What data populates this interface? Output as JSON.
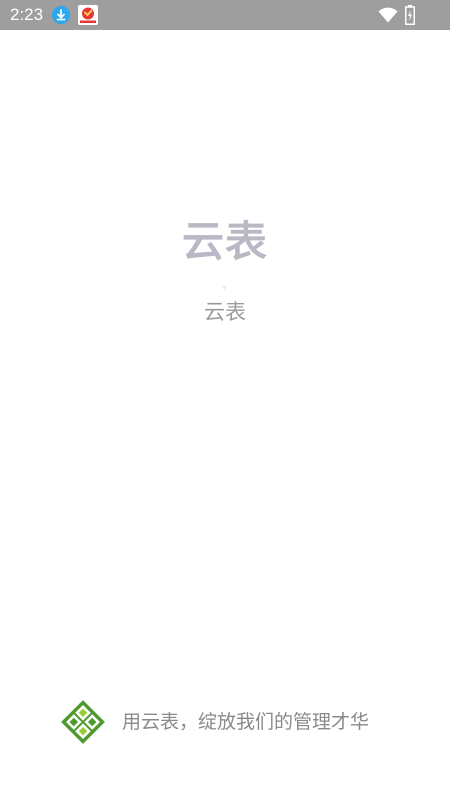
{
  "status_bar": {
    "time": "2:23",
    "icons": [
      "download-notification-icon",
      "app-notification-icon",
      "wifi-icon",
      "battery-charging-icon"
    ]
  },
  "splash": {
    "title": "云表",
    "subtitle": "云表"
  },
  "footer": {
    "slogan": "用云表，绽放我们的管理才华",
    "logo_icon": "yunbiao-logo-icon"
  },
  "colors": {
    "status_bar": "#9e9e9e",
    "title": "#b9b9c6",
    "subtitle": "#9b9b9b",
    "slogan": "#8a8a8a",
    "logo_green_dark": "#4f9a2e",
    "logo_green_light": "#9acd32",
    "download_badge": "#29a8f0"
  }
}
